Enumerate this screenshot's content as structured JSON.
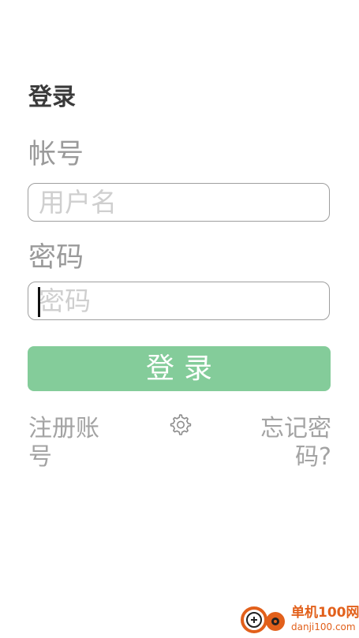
{
  "login": {
    "title": "登录",
    "account_label": "帐号",
    "username_placeholder": "用户名",
    "password_label": "密码",
    "password_placeholder": "密码",
    "login_button": "登录",
    "register_link": "注册账号",
    "forgot_link": "忘记密码?",
    "settings_icon": "gear-icon"
  },
  "watermark": {
    "name": "单机100网",
    "url": "danji100.com"
  },
  "colors": {
    "accent": "#84cc9a",
    "label": "#9a9a9a",
    "placeholder": "#cfcfcf",
    "watermark": "#e2601b"
  }
}
